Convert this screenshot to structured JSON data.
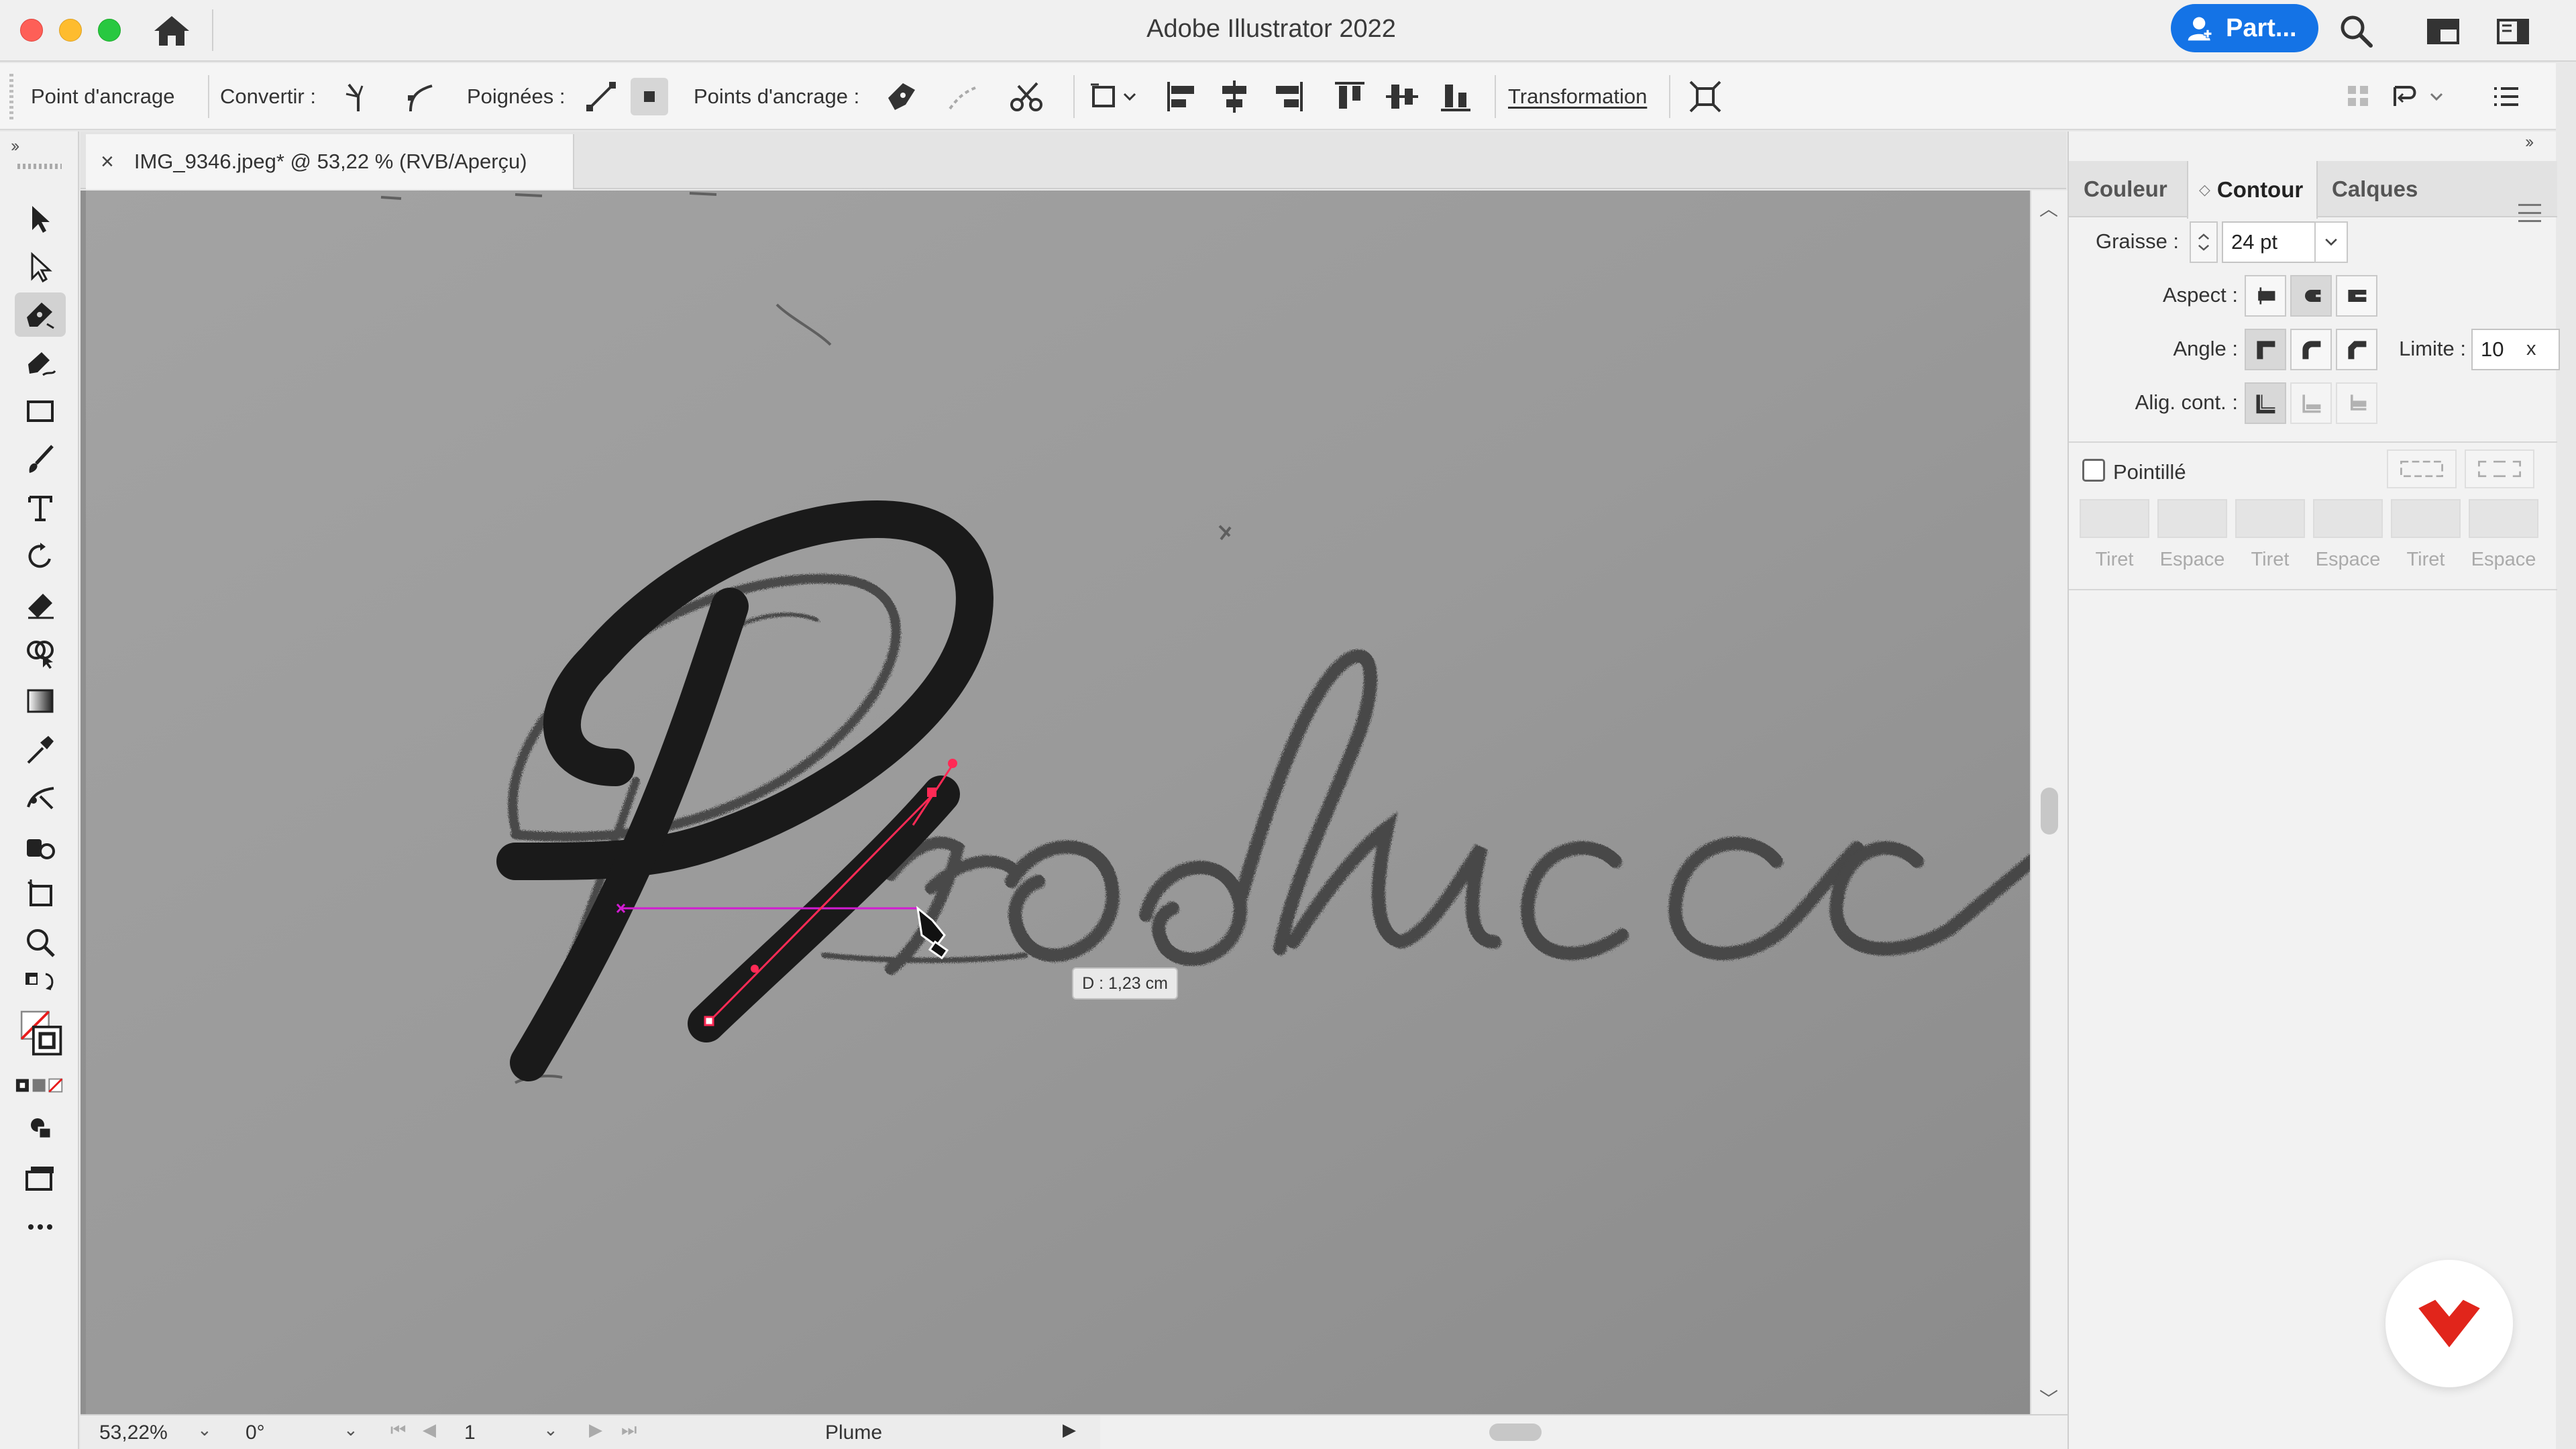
{
  "window": {
    "title": "Adobe Illustrator 2022",
    "share_label": "Part..."
  },
  "control_bar": {
    "anchor_point_label": "Point d'ancrage",
    "convert_label": "Convertir :",
    "handles_label": "Poignées :",
    "anchor_points_label": "Points d'ancrage :",
    "transform_label": "Transformation"
  },
  "document": {
    "tab_title": "IMG_9346.jpeg* @ 53,22 % (RVB/Aperçu)",
    "close_glyph": "×",
    "measure_tooltip": "D : 1,23 cm"
  },
  "status_bar": {
    "zoom": "53,22%",
    "rotation": "0°",
    "artboard": "1",
    "current_tool": "Plume"
  },
  "panel": {
    "tabs": [
      {
        "label": "Couleur"
      },
      {
        "label": "Contour"
      },
      {
        "label": "Calques"
      }
    ],
    "weight_label": "Graisse :",
    "weight_value": "24 pt",
    "cap_label": "Aspect :",
    "corner_label": "Angle :",
    "limit_label": "Limite :",
    "limit_value": "10",
    "limit_unit": "x",
    "align_label": "Alig. cont. :",
    "dashed_label": "Pointillé",
    "dash_labels": [
      "Tiret",
      "Espace",
      "Tiret",
      "Espace",
      "Tiret",
      "Espace"
    ]
  },
  "colors": {
    "accent": "#1473e6",
    "path_stroke": "#ff2a55",
    "guide": "#d21cd2",
    "brand": "#e1251b"
  }
}
